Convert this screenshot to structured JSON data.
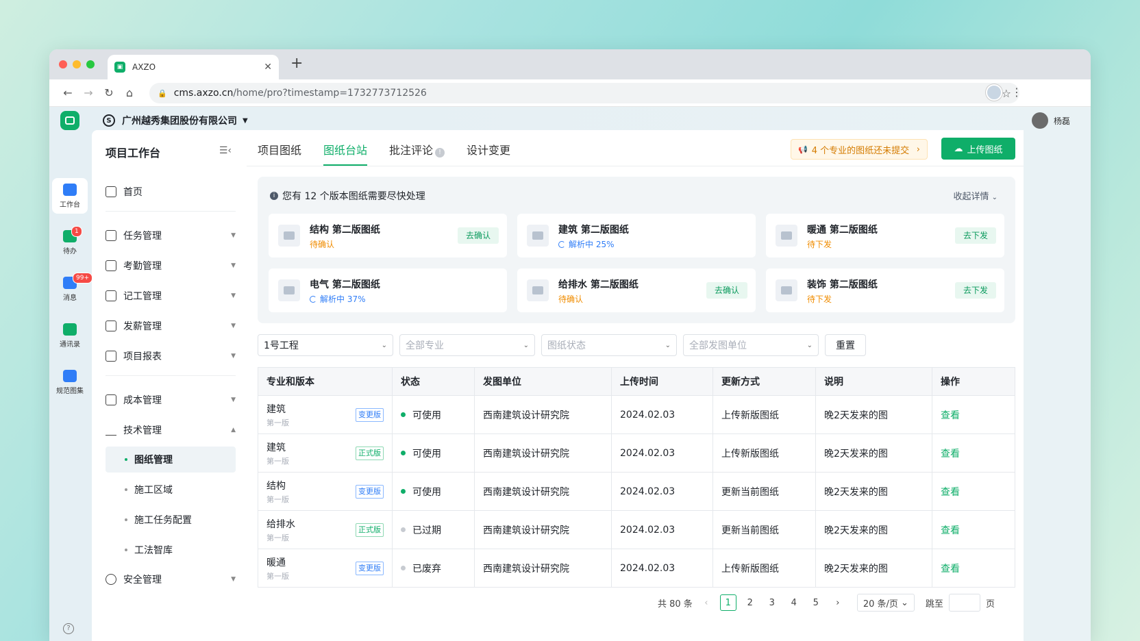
{
  "browser": {
    "tab_title": "AXZO",
    "url_host": "cms.axzo.cn",
    "url_path": "/home/pro?timestamp=1732773712526"
  },
  "header": {
    "company": "广州越秀集团股份有限公司",
    "user": "杨磊"
  },
  "rail": [
    {
      "label": "工作台",
      "color": "#2f7df7"
    },
    {
      "label": "待办",
      "badge": "1",
      "color": "#0fae69"
    },
    {
      "label": "消息",
      "badge": "99+",
      "color": "#2f7df7"
    },
    {
      "label": "通讯录",
      "color": "#0fae69"
    },
    {
      "label": "规范图集",
      "color": "#2f7df7"
    }
  ],
  "sidebar": {
    "title": "项目工作台",
    "home": "首页",
    "items": [
      "任务管理",
      "考勤管理",
      "记工管理",
      "发薪管理",
      "项目报表",
      "成本管理",
      "技术管理"
    ],
    "subitems": [
      "图纸管理",
      "施工区域",
      "施工任务配置",
      "工法智库"
    ],
    "safety": "安全管理"
  },
  "tabs": [
    "项目图纸",
    "图纸台站",
    "批注评论",
    "设计变更"
  ],
  "notice": "4 个专业的图纸还未提交",
  "upload_label": "上传图纸",
  "panel": {
    "title": "您有 12 个版本图纸需要尽快处理",
    "collapse": "收起详情",
    "cards": [
      {
        "title": "结构 第二版图纸",
        "status": "待确认",
        "action": "去确认",
        "kind": "orange"
      },
      {
        "title": "建筑 第二版图纸",
        "status": "解析中 25%",
        "action": "",
        "kind": "blue"
      },
      {
        "title": "暖通 第二版图纸",
        "status": "待下发",
        "action": "去下发",
        "kind": "orange"
      },
      {
        "title": "电气 第二版图纸",
        "status": "解析中 37%",
        "action": "",
        "kind": "blue"
      },
      {
        "title": "给排水 第二版图纸",
        "status": "待确认",
        "action": "去确认",
        "kind": "orange"
      },
      {
        "title": "装饰 第二版图纸",
        "status": "待下发",
        "action": "去下发",
        "kind": "orange"
      }
    ]
  },
  "filters": {
    "project": "1号工程",
    "major": "全部专业",
    "status": "图纸状态",
    "unit": "全部发图单位",
    "reset": "重置"
  },
  "table": {
    "headers": [
      "专业和版本",
      "状态",
      "发图单位",
      "上传时间",
      "更新方式",
      "说明",
      "操作"
    ],
    "rows": [
      {
        "name": "建筑",
        "ver": "第一版",
        "tag": "变更版",
        "tagc": "b",
        "status": "可使用",
        "dot": "#0fae69",
        "unit": "西南建筑设计研究院",
        "time": "2024.02.03",
        "mode": "上传新版图纸",
        "note": "晚2天发来的图",
        "op": "查看"
      },
      {
        "name": "建筑",
        "ver": "第一版",
        "tag": "正式版",
        "tagc": "g",
        "status": "可使用",
        "dot": "#0fae69",
        "unit": "西南建筑设计研究院",
        "time": "2024.02.03",
        "mode": "上传新版图纸",
        "note": "晚2天发来的图",
        "op": "查看"
      },
      {
        "name": "结构",
        "ver": "第一版",
        "tag": "变更版",
        "tagc": "b",
        "status": "可使用",
        "dot": "#0fae69",
        "unit": "西南建筑设计研究院",
        "time": "2024.02.03",
        "mode": "更新当前图纸",
        "note": "晚2天发来的图",
        "op": "查看"
      },
      {
        "name": "给排水",
        "ver": "第一版",
        "tag": "正式版",
        "tagc": "g",
        "status": "已过期",
        "dot": "#c7cbd1",
        "unit": "西南建筑设计研究院",
        "time": "2024.02.03",
        "mode": "更新当前图纸",
        "note": "晚2天发来的图",
        "op": "查看"
      },
      {
        "name": "暖通",
        "ver": "第一版",
        "tag": "变更版",
        "tagc": "b",
        "status": "已废弃",
        "dot": "#c7cbd1",
        "unit": "西南建筑设计研究院",
        "time": "2024.02.03",
        "mode": "上传新版图纸",
        "note": "晚2天发来的图",
        "op": "查看"
      }
    ]
  },
  "pager": {
    "total": "共 80 条",
    "pages": [
      "1",
      "2",
      "3",
      "4",
      "5"
    ],
    "per_page": "20 条/页",
    "jump": "跳至",
    "page_unit": "页"
  }
}
